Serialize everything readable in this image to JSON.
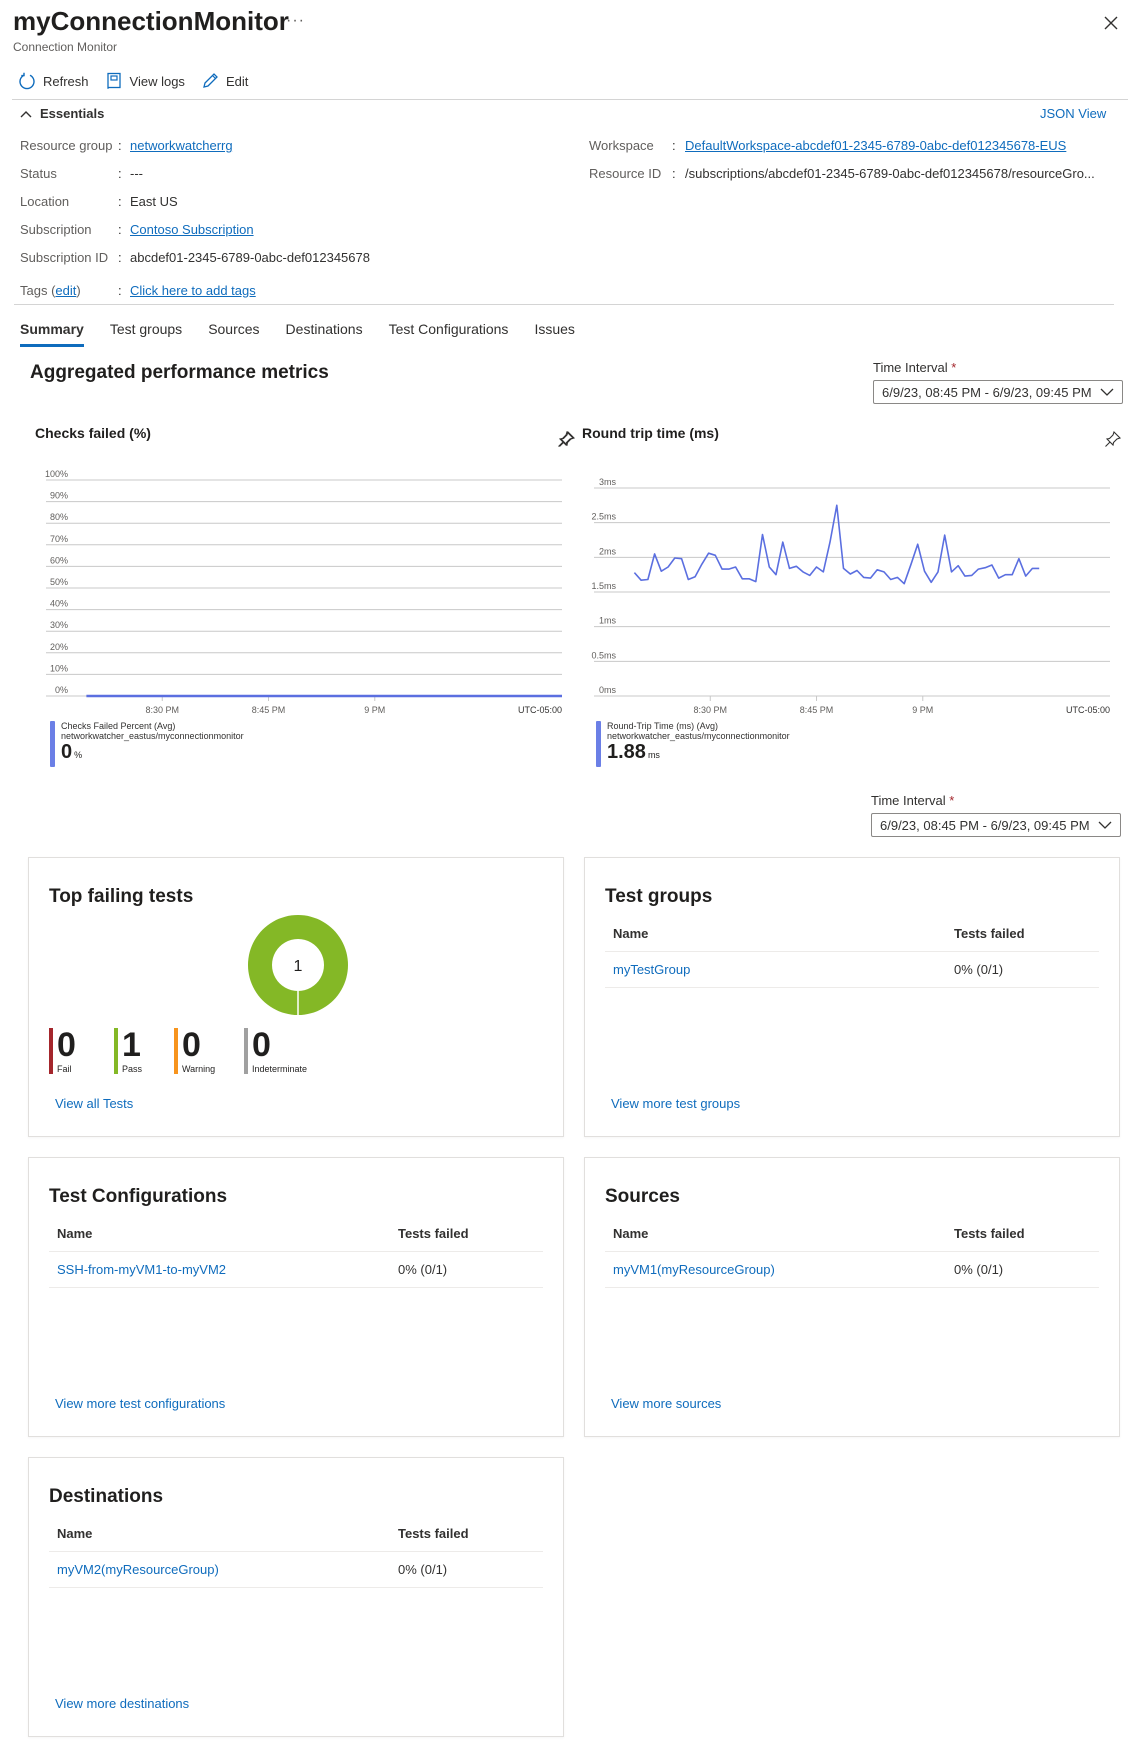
{
  "header": {
    "title": "myConnectionMonitor",
    "subtitle": "Connection Monitor",
    "more_label": "···"
  },
  "toolbar": {
    "refresh": "Refresh",
    "view_logs": "View logs",
    "edit": "Edit"
  },
  "essentials": {
    "toggle_label": "Essentials",
    "json_view": "JSON View",
    "left": [
      {
        "label": "Resource group",
        "value": "networkwatcherrg",
        "link": true
      },
      {
        "label": "Status",
        "value": "---",
        "link": false
      },
      {
        "label": "Location",
        "value": "East US",
        "link": false
      },
      {
        "label": "Subscription",
        "value": "Contoso Subscription",
        "link": true
      },
      {
        "label": "Subscription ID",
        "value": "abcdef01-2345-6789-0abc-def012345678",
        "link": false
      }
    ],
    "right": [
      {
        "label": "Workspace",
        "value": "DefaultWorkspace-abcdef01-2345-6789-0abc-def012345678-EUS",
        "link": true
      },
      {
        "label": "Resource ID",
        "value": "/subscriptions/abcdef01-2345-6789-0abc-def012345678/resourceGro...",
        "link": false
      }
    ],
    "tags_label": "Tags",
    "tags_edit": "edit",
    "tags_value": "Click here to add tags"
  },
  "tabs": [
    {
      "label": "Summary",
      "active": true
    },
    {
      "label": "Test groups",
      "active": false
    },
    {
      "label": "Sources",
      "active": false
    },
    {
      "label": "Destinations",
      "active": false
    },
    {
      "label": "Test Configurations",
      "active": false
    },
    {
      "label": "Issues",
      "active": false
    }
  ],
  "metrics": {
    "section_title": "Aggregated performance metrics",
    "time_interval_label": "Time Interval",
    "required_mark": "*",
    "time_interval_value": "6/9/23, 08:45 PM - 6/9/23, 09:45 PM"
  },
  "chart_data": [
    {
      "type": "line",
      "title": "Checks failed (%)",
      "y_ticks": [
        "100%",
        "90%",
        "80%",
        "70%",
        "60%",
        "50%",
        "40%",
        "30%",
        "20%",
        "10%",
        "0%"
      ],
      "ylim": [
        0,
        100
      ],
      "x_ticks": [
        "8:30 PM",
        "8:45 PM",
        "9 PM"
      ],
      "timezone": "UTC-05:00",
      "series": [
        {
          "name": "Checks Failed Percent (Avg)",
          "color": "#5b6fe0",
          "values": [
            0,
            0
          ]
        }
      ],
      "legend": {
        "name": "Checks Failed Percent (Avg)",
        "resource": "networkwatcher_eastus/myconnectionmonitor",
        "value": "0",
        "unit": "%"
      },
      "grid": true
    },
    {
      "type": "line",
      "title": "Round trip time (ms)",
      "y_ticks": [
        "3ms",
        "2.5ms",
        "2ms",
        "1.5ms",
        "1ms",
        "0.5ms",
        "0ms"
      ],
      "ylim": [
        0,
        3
      ],
      "x_ticks": [
        "8:30 PM",
        "8:45 PM",
        "9 PM"
      ],
      "timezone": "UTC-05:00",
      "series": [
        {
          "name": "Round-Trip Time (ms) (Avg)",
          "color": "#5b6fe0",
          "values": [
            1.78,
            1.67,
            1.68,
            2.05,
            1.8,
            1.86,
            1.99,
            1.98,
            1.68,
            1.72,
            1.9,
            2.06,
            2.03,
            1.83,
            1.83,
            1.86,
            1.69,
            1.69,
            1.65,
            2.33,
            1.86,
            1.75,
            2.22,
            1.84,
            1.87,
            1.79,
            1.74,
            1.86,
            1.79,
            2.22,
            2.75,
            1.84,
            1.76,
            1.81,
            1.71,
            1.7,
            1.82,
            1.79,
            1.68,
            1.71,
            1.62,
            1.9,
            2.19,
            1.8,
            1.64,
            1.79,
            2.32,
            1.79,
            1.88,
            1.73,
            1.74,
            1.83,
            1.85,
            1.89,
            1.7,
            1.75,
            1.75,
            1.98,
            1.73,
            1.84,
            1.84
          ]
        }
      ],
      "legend": {
        "name": "Round-Trip Time (ms) (Avg)",
        "resource": "networkwatcher_eastus/myconnectionmonitor",
        "value": "1.88",
        "unit": "ms"
      },
      "grid": true
    },
    {
      "type": "pie",
      "title": "Top failing tests",
      "center_label": "1",
      "slices": [
        {
          "name": "Fail",
          "value": 0,
          "color": "#a4262c"
        },
        {
          "name": "Pass",
          "value": 1,
          "color": "#84b826"
        },
        {
          "name": "Warning",
          "value": 0,
          "color": "#f7941d"
        },
        {
          "name": "Indeterminate",
          "value": 0,
          "color": "#a0a0a0"
        }
      ]
    }
  ],
  "second_time_interval": {
    "label": "Time Interval",
    "required_mark": "*",
    "value": "6/9/23, 08:45 PM - 6/9/23, 09:45 PM"
  },
  "top_failing": {
    "title": "Top failing tests",
    "stats": [
      {
        "label": "Fail",
        "value": "0",
        "color": "#a4262c"
      },
      {
        "label": "Pass",
        "value": "1",
        "color": "#84b826"
      },
      {
        "label": "Warning",
        "value": "0",
        "color": "#f7941d"
      },
      {
        "label": "Indeterminate",
        "value": "0",
        "color": "#a0a0a0"
      }
    ],
    "view_all": "View all Tests"
  },
  "cards": {
    "test_groups": {
      "title": "Test groups",
      "col_name": "Name",
      "col_failed": "Tests failed",
      "rows": [
        {
          "name": "myTestGroup",
          "failed": "0% (0/1)"
        }
      ],
      "view_more": "View more test groups"
    },
    "test_configurations": {
      "title": "Test Configurations",
      "col_name": "Name",
      "col_failed": "Tests failed",
      "rows": [
        {
          "name": "SSH-from-myVM1-to-myVM2",
          "failed": "0% (0/1)"
        }
      ],
      "view_more": "View more test configurations"
    },
    "sources": {
      "title": "Sources",
      "col_name": "Name",
      "col_failed": "Tests failed",
      "rows": [
        {
          "name": "myVM1(myResourceGroup)",
          "failed": "0% (0/1)"
        }
      ],
      "view_more": "View more sources"
    },
    "destinations": {
      "title": "Destinations",
      "col_name": "Name",
      "col_failed": "Tests failed",
      "rows": [
        {
          "name": "myVM2(myResourceGroup)",
          "failed": "0% (0/1)"
        }
      ],
      "view_more": "View more destinations"
    }
  }
}
